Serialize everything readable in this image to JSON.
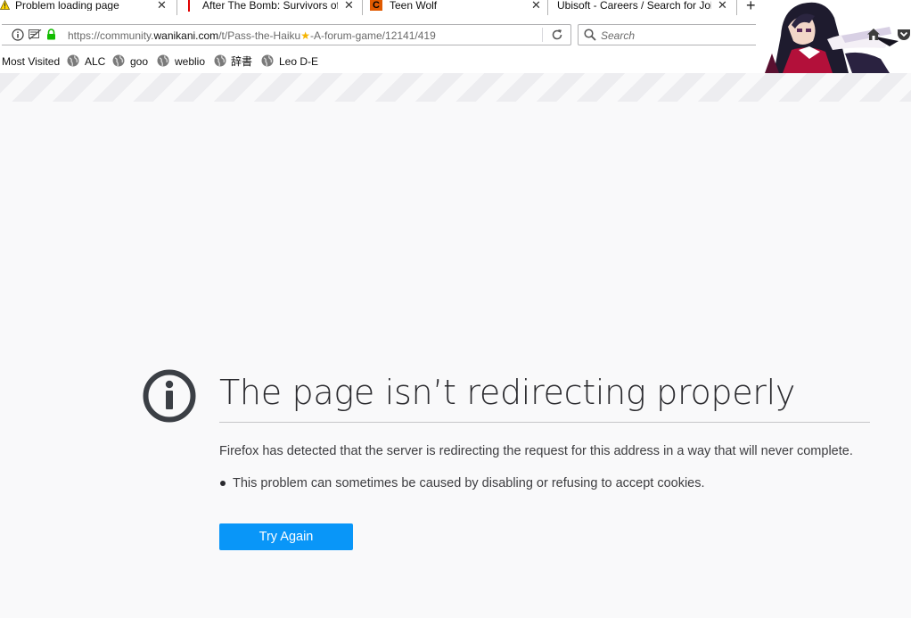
{
  "tabs": [
    {
      "title": "Problem loading page",
      "active": true
    },
    {
      "title": "After The Bomb: Survivors of",
      "active": false
    },
    {
      "title": "Teen Wolf",
      "active": false
    },
    {
      "title": "Ubisoft - Careers / Search for Job",
      "active": false
    }
  ],
  "urlbar": {
    "url_prefix": "https://community.",
    "url_domain": "wanikani.com",
    "url_path": "/t/Pass-the-Haiku",
    "url_star": "★",
    "url_rest": "-A-forum-game/12141/419"
  },
  "search": {
    "placeholder": "Search"
  },
  "bookmarks": {
    "most_visited": "Most Visited",
    "items": [
      "ALC",
      "goo",
      "weblio",
      "辞書",
      "Leo D-E"
    ]
  },
  "error": {
    "title": "The page isn’t redirecting properly",
    "description": "Firefox has detected that the server is redirecting the request for this address in a way that will never complete.",
    "bullet": "This problem can sometimes be caused by disabling or refusing to accept cookies.",
    "button": "Try Again"
  },
  "colors": {
    "button": "#0996f8",
    "icon": "#3b3f45"
  }
}
